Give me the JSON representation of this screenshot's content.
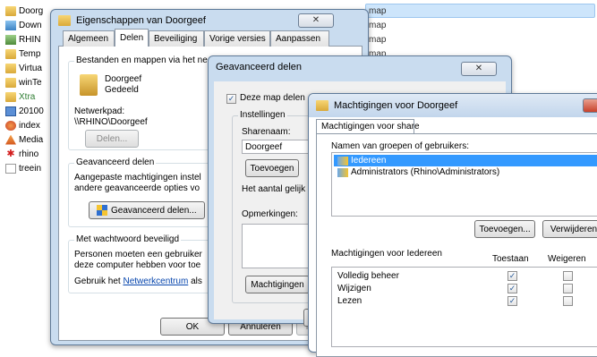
{
  "explorer": {
    "files": [
      {
        "name": "Doorg",
        "icon": "folder-icon"
      },
      {
        "name": "Down",
        "icon": "download-folder-icon"
      },
      {
        "name": "RHIN",
        "icon": "network-icon"
      },
      {
        "name": "Temp",
        "icon": "folder-icon"
      },
      {
        "name": "Virtua",
        "icon": "folder-icon"
      },
      {
        "name": "winTe",
        "icon": "folder-icon"
      },
      {
        "name": "Xtra",
        "icon": "folder-icon"
      },
      {
        "name": "20100",
        "icon": "image-file-icon"
      },
      {
        "name": "index",
        "icon": "html-file-icon"
      },
      {
        "name": "Media",
        "icon": "media-icon"
      },
      {
        "name": "rhino",
        "icon": "app-icon"
      },
      {
        "name": "treein",
        "icon": "text-file-icon"
      }
    ],
    "type_column": [
      "map",
      "map",
      "map",
      "map"
    ]
  },
  "properties_dialog": {
    "title": "Eigenschappen van Doorgeef",
    "close_label": "✕",
    "tabs": [
      "Algemeen",
      "Delen",
      "Beveiliging",
      "Vorige versies",
      "Aanpassen"
    ],
    "active_tab": "Delen",
    "section_share_title": "Bestanden en mappen via het ne",
    "folder_name": "Doorgeef",
    "folder_status": "Gedeeld",
    "network_path_label": "Netwerkpad:",
    "network_path": "\\\\RHINO\\Doorgeef",
    "share_button": "Delen...",
    "advanced_group_label": "Geavanceerd delen",
    "advanced_desc_line1": "Aangepaste machtigingen instel",
    "advanced_desc_line2": "andere geavanceerde opties vo",
    "advanced_button": "Geavanceerd delen...",
    "password_group_label": "Met wachtwoord beveiligd",
    "password_desc_line1": "Personen moeten een gebruiker",
    "password_desc_line2": "deze computer hebben voor toe",
    "password_desc_line3_prefix": "Gebruik het ",
    "password_link": "Netwerkcentrum",
    "password_desc_line3_suffix": " als",
    "ok_button": "OK",
    "cancel_button": "Annuleren",
    "apply_button": "T"
  },
  "advanced_dialog": {
    "title": "Geavanceerd delen",
    "close_label": "✕",
    "share_checkbox_label": "Deze map delen",
    "share_checked": true,
    "settings_label": "Instellingen",
    "share_name_label": "Sharenaam:",
    "share_name_value": "Doorgeef",
    "add_button": "Toevoegen",
    "user_limit_label": "Het aantal gelijk",
    "comments_label": "Opmerkingen:",
    "permissions_button": "Machtigingen",
    "ok_button_partial": "C"
  },
  "permissions_dialog": {
    "title": "Machtigingen voor Doorgeef",
    "tab_label": "Machtigingen voor share",
    "groups_label": "Namen van groepen of gebruikers:",
    "users": [
      {
        "name": "Iedereen",
        "selected": true
      },
      {
        "name": "Administrators (Rhino\\Administrators)",
        "selected": false
      }
    ],
    "add_button": "Toevoegen...",
    "remove_button": "Verwijderen",
    "permissions_for_label": "Machtigingen voor Iedereen",
    "allow_header": "Toestaan",
    "deny_header": "Weigeren",
    "permissions": [
      {
        "name": "Volledig beheer",
        "allow": true,
        "deny": false
      },
      {
        "name": "Wijzigen",
        "allow": true,
        "deny": false
      },
      {
        "name": "Lezen",
        "allow": true,
        "deny": false
      }
    ]
  },
  "colors": {
    "chrome": "#c9dcef",
    "selection": "#cde5fb",
    "close_red": "#c8412a"
  }
}
